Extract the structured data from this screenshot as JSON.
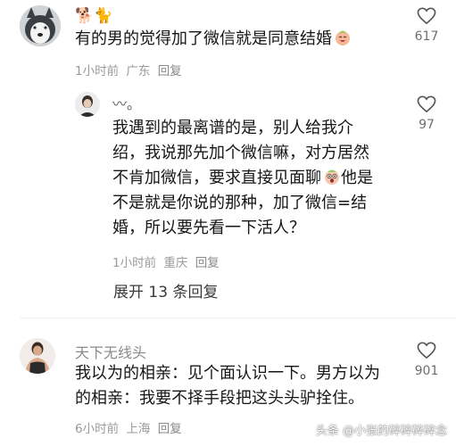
{
  "comments": [
    {
      "name": "🐕🐈",
      "text": "有的男的觉得加了微信就是同意结婚",
      "time": "1小时前",
      "location": "广东",
      "reply_label": "回复",
      "likes": "617",
      "avatar_icon": "husky-dog-avatar"
    },
    {
      "name": "〰。",
      "text_lines": [
        "我遇到的最离谱的是，别人给我介",
        "绍，我说那先加个微信嘛，对方居然",
        "不肯加微信，要求直接见面聊",
        "他是",
        "不是就是你说的那种，加了微信=结",
        "婚，所以要先看一下活人？"
      ],
      "time": "1小时前",
      "location": "重庆",
      "reply_label": "回复",
      "likes": "97",
      "avatar_icon": "person-avatar"
    },
    {
      "name": "天下无线头",
      "text_lines": [
        "我以为的相亲：见个面认识一下。男方以为",
        "的相亲：我要不择手段把这头头驴拴住。"
      ],
      "time": "6小时前",
      "location": "上海",
      "reply_label": "回复",
      "likes": "901",
      "avatar_icon": "athlete-avatar"
    }
  ],
  "expand_replies": "展开 13 条回复",
  "watermark": "头条 @小张的碎碎碎碎念",
  "colors": {
    "text": "#161616",
    "meta": "#9a9a9a",
    "name": "#8a8a8a",
    "background": "#ffffff"
  }
}
